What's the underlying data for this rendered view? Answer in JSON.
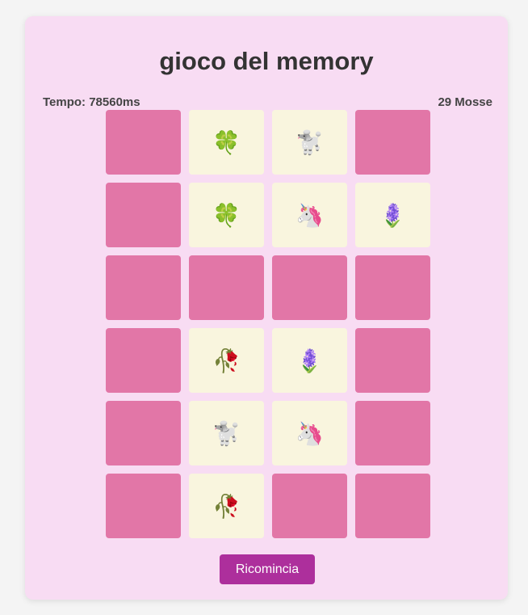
{
  "title": "gioco del memory",
  "stats": {
    "time": "Tempo: 78560ms",
    "moves": "29 Mosse"
  },
  "colors": {
    "card_back": "#e276a7",
    "card_face": "#f9f5de",
    "panel": "#f8dcf3",
    "button": "#ad2f9c"
  },
  "cards": [
    {
      "state": "down",
      "face": ""
    },
    {
      "state": "up",
      "face": "🍀",
      "icon": "four-leaf-clover-icon"
    },
    {
      "state": "up",
      "face": "🐩",
      "icon": "poodle-icon"
    },
    {
      "state": "down",
      "face": ""
    },
    {
      "state": "down",
      "face": ""
    },
    {
      "state": "up",
      "face": "🍀",
      "icon": "four-leaf-clover-icon"
    },
    {
      "state": "up",
      "face": "🦄",
      "icon": "unicorn-icon"
    },
    {
      "state": "up",
      "face": "🪻",
      "icon": "hyacinth-icon"
    },
    {
      "state": "down",
      "face": ""
    },
    {
      "state": "down",
      "face": ""
    },
    {
      "state": "down",
      "face": ""
    },
    {
      "state": "down",
      "face": ""
    },
    {
      "state": "down",
      "face": ""
    },
    {
      "state": "up",
      "face": "🥀",
      "icon": "wilted-flower-icon"
    },
    {
      "state": "up",
      "face": "🪻",
      "icon": "hyacinth-icon"
    },
    {
      "state": "down",
      "face": ""
    },
    {
      "state": "down",
      "face": ""
    },
    {
      "state": "up",
      "face": "🐩",
      "icon": "poodle-icon"
    },
    {
      "state": "up",
      "face": "🦄",
      "icon": "unicorn-icon"
    },
    {
      "state": "down",
      "face": ""
    },
    {
      "state": "down",
      "face": ""
    },
    {
      "state": "up",
      "face": "🥀",
      "icon": "wilted-flower-icon"
    },
    {
      "state": "down",
      "face": ""
    },
    {
      "state": "down",
      "face": ""
    }
  ],
  "restart_label": "Ricomincia"
}
